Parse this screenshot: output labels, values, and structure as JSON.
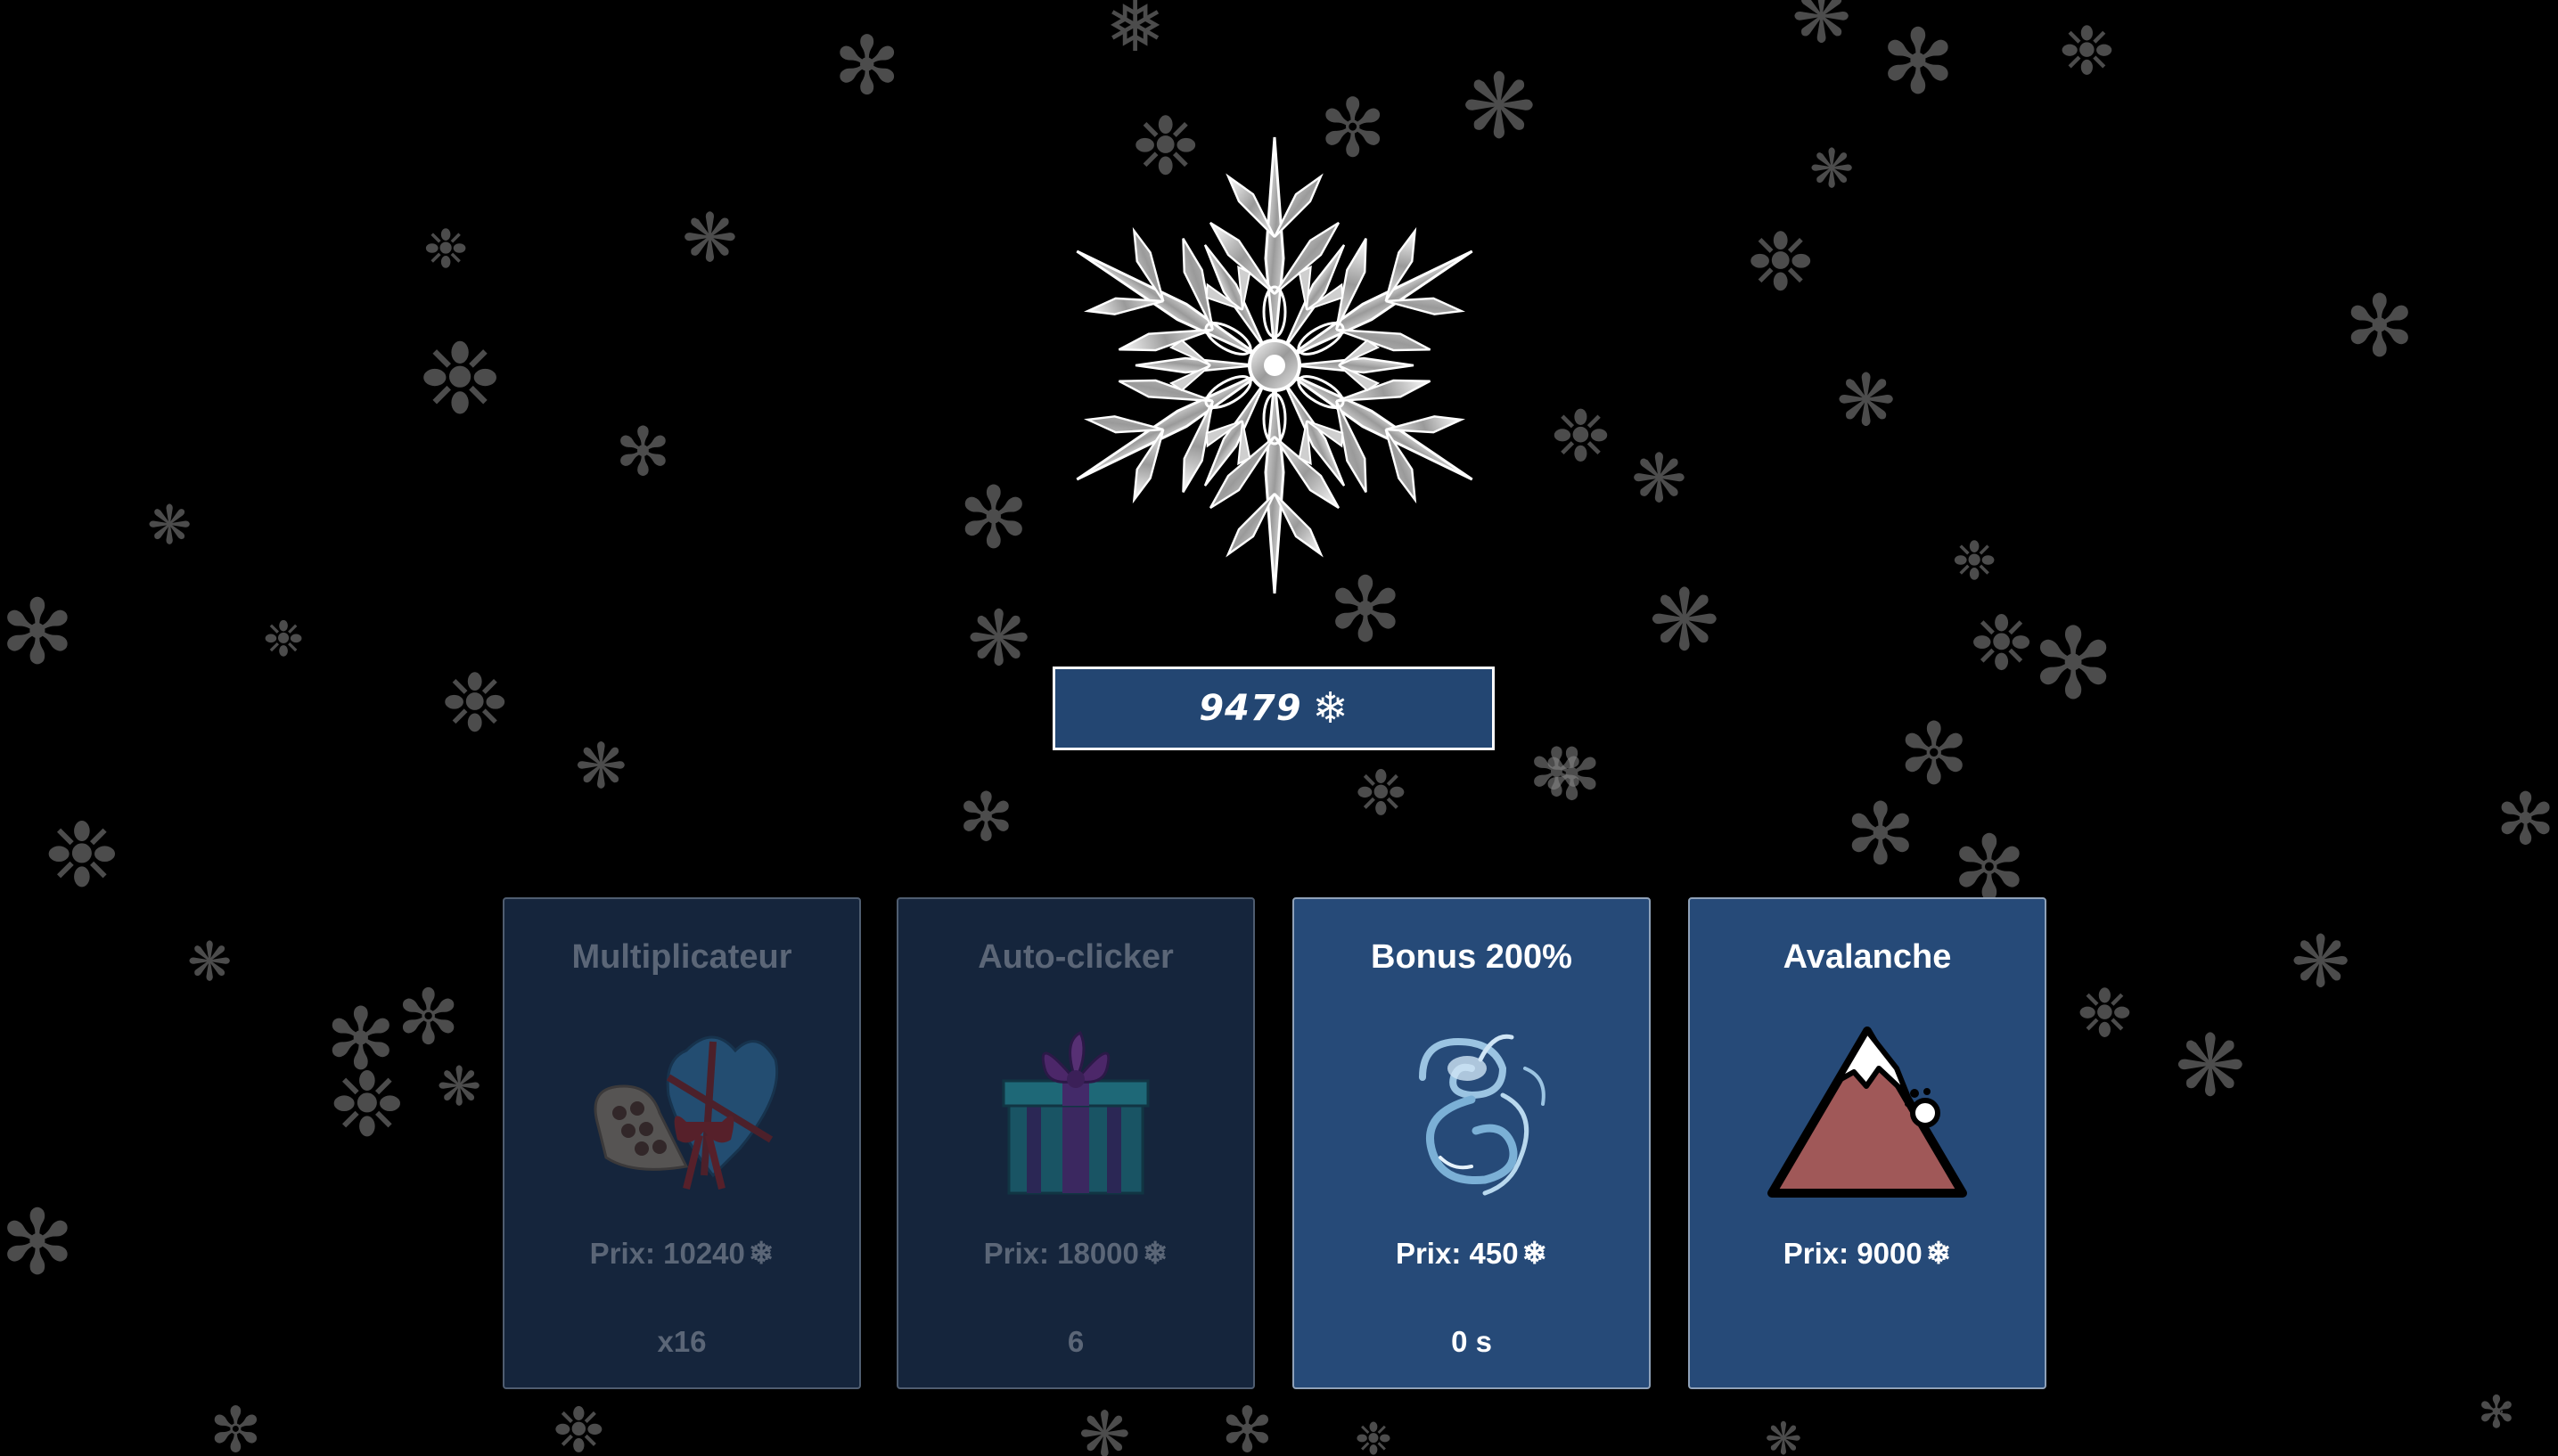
{
  "game": {
    "score": "9479",
    "currency_symbol": "❄",
    "currency_icon": "snowflake-icon"
  },
  "main_snowflake": {
    "icon": "crystal-snowflake",
    "color": "#e8e8e8"
  },
  "shop": {
    "items": [
      {
        "title": "Multiplicateur",
        "icon": "heart-chocolate-box-icon",
        "price": "Prix: 10240",
        "footer": "x16",
        "enabled": false
      },
      {
        "title": "Auto-clicker",
        "icon": "gift-box-icon",
        "price": "Prix: 18000",
        "footer": "6",
        "enabled": false
      },
      {
        "title": "Bonus 200%",
        "icon": "ice-swirl-icon",
        "price": "Prix: 450",
        "footer": "0 s",
        "enabled": true
      },
      {
        "title": "Avalanche",
        "icon": "avalanche-mountain-icon",
        "price": "Prix: 9000",
        "footer": "",
        "enabled": true
      }
    ]
  },
  "colors": {
    "background": "#000000",
    "panel": "#234672",
    "card_enabled": "#264a78",
    "card_disabled": "#15253c",
    "mountain": "#a05858"
  }
}
